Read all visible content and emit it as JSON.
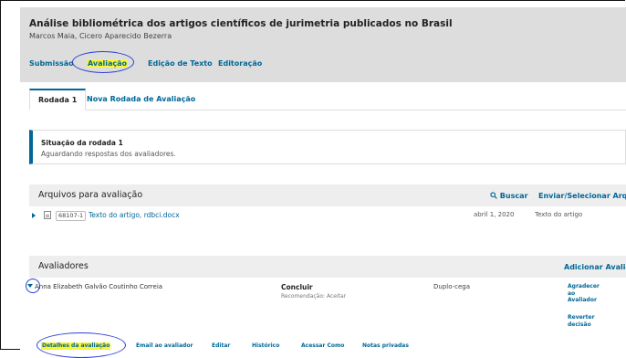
{
  "header": {
    "title": "Análise bibliométrica dos artigos científicos de jurimetria publicados no Brasil",
    "authors": "Marcos Maia, Cicero Aparecido Bezerra"
  },
  "tabs": [
    {
      "label": "Submissão"
    },
    {
      "label": "Avaliação"
    },
    {
      "label": "Edição de Texto"
    },
    {
      "label": "Editoração"
    }
  ],
  "round_tabs": [
    {
      "label": "Rodada 1"
    },
    {
      "label": "Nova Rodada de Avaliação"
    }
  ],
  "status": {
    "title": "Situação da rodada 1",
    "text": "Aguardando respostas dos avaliadores."
  },
  "files_panel": {
    "title": "Arquivos para avaliação",
    "search_label": "Buscar",
    "upload_label": "Enviar/Selecionar Arquivos",
    "file": {
      "id": "68107-1",
      "name": "Texto do artigo, rdbci.docx",
      "date": "abril 1, 2020",
      "type": "Texto do artigo"
    }
  },
  "reviewers_panel": {
    "title": "Avaliadores",
    "add_label": "Adicionar Avaliador",
    "reviewer": {
      "name": "Anna Elizabeth Galvão Coutinho Correia",
      "status": "Concluir",
      "recommendation": "Recomendação: Aceitar",
      "method": "Duplo-cega",
      "thank_label": "Agradecer ao Avaliador",
      "revert_label": "Reverter decisão"
    },
    "actions": [
      {
        "label": "Detalhes da avaliação"
      },
      {
        "label": "Email ao avaliador"
      },
      {
        "label": "Editar"
      },
      {
        "label": "Histórico"
      },
      {
        "label": "Acessar Como"
      },
      {
        "label": "Notas privadas"
      }
    ]
  },
  "colors": {
    "link": "#006798",
    "highlight": "#f7f43a",
    "annotation_circle": "#2a3fd6",
    "header_bg": "#dddddd",
    "panel_head_bg": "#eeeeee"
  },
  "icons": {
    "search": "search-icon",
    "expand": "triangle-right-icon",
    "collapse": "triangle-down-icon",
    "file": "file-icon"
  }
}
